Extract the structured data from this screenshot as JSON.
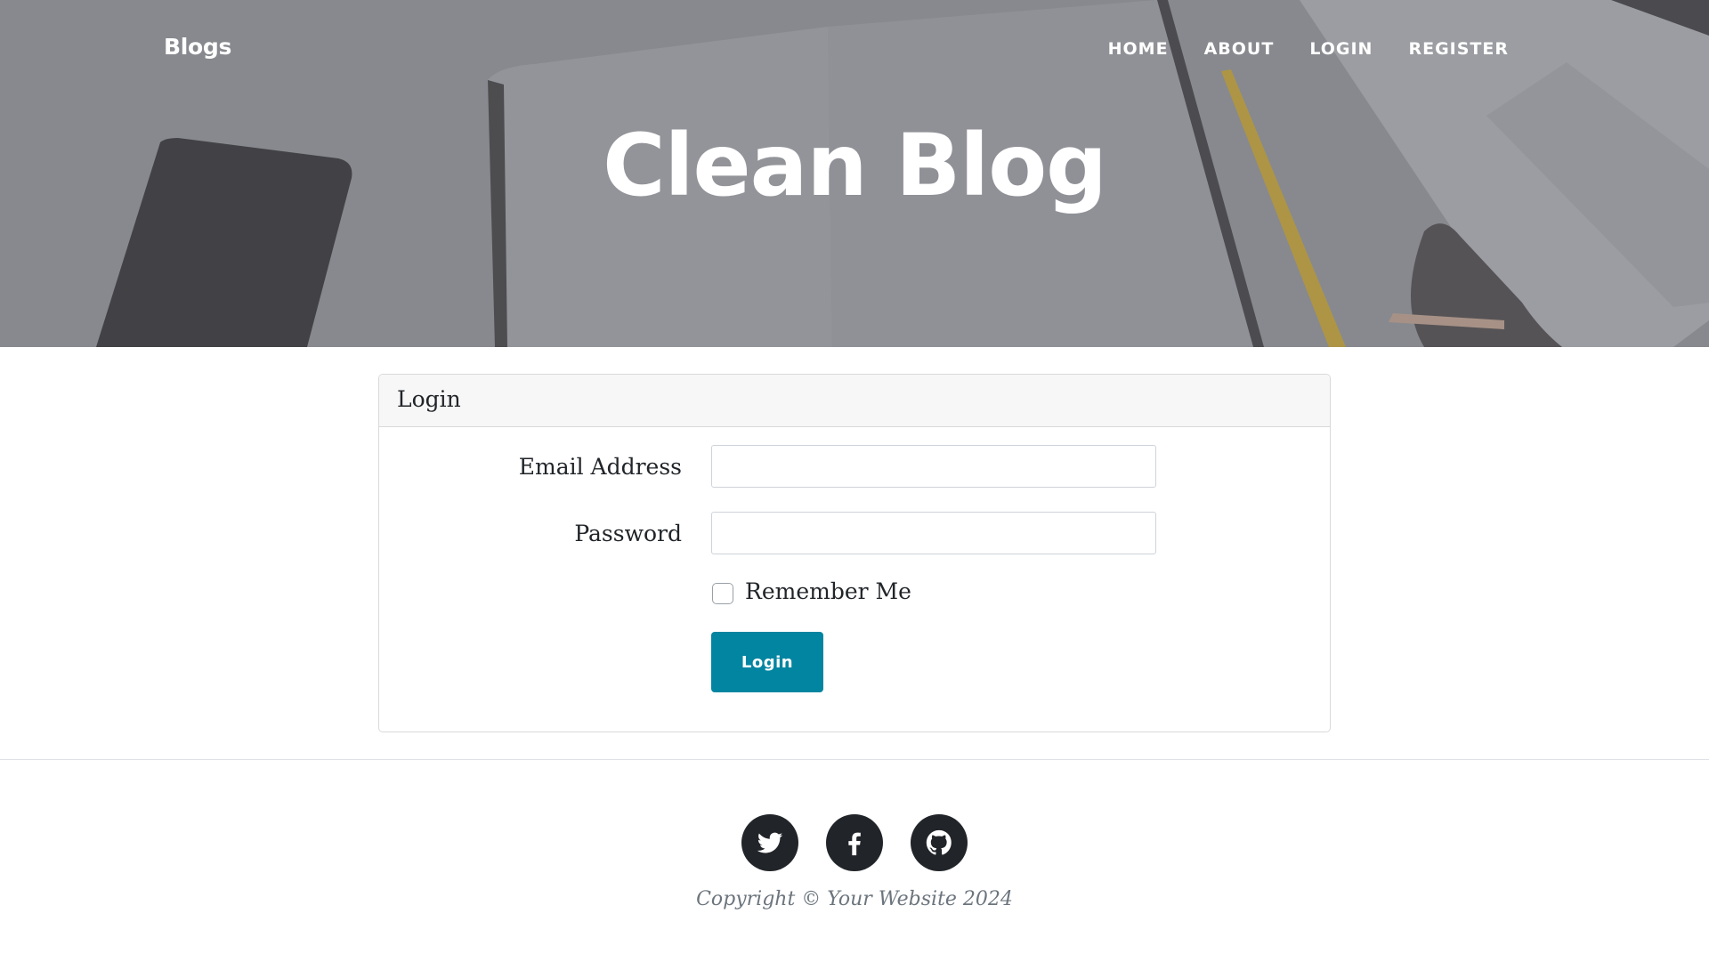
{
  "nav": {
    "brand": "Blogs",
    "links": [
      "HOME",
      "ABOUT",
      "LOGIN",
      "REGISTER"
    ]
  },
  "hero": {
    "title": "Clean Blog"
  },
  "login_card": {
    "header": "Login",
    "email_label": "Email Address",
    "email_value": "",
    "password_label": "Password",
    "password_value": "",
    "remember_label": "Remember Me",
    "remember_checked": false,
    "submit_label": "Login"
  },
  "footer": {
    "social_icons": [
      "twitter-icon",
      "facebook-icon",
      "github-icon"
    ],
    "copyright": "Copyright © Your Website 2024"
  },
  "colors": {
    "button": "#0285a1",
    "footer_icon_bg": "#212529",
    "copyright_text": "#6c757d"
  }
}
